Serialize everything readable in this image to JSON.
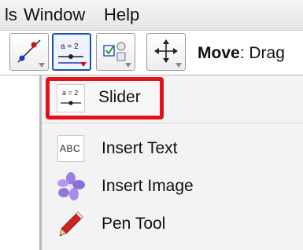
{
  "menubar": {
    "items": [
      "ls",
      "Window",
      "Help"
    ]
  },
  "toolbar": {
    "tools": [
      {
        "icon": "line-through-two-points-icon",
        "selected": false
      },
      {
        "icon": "slider-icon",
        "icon_text": "a = 2",
        "selected": true
      },
      {
        "icon": "checkbox-icon",
        "selected": false
      },
      {
        "icon": "move-icon",
        "selected": false
      }
    ],
    "mode_label": "Move",
    "mode_suffix": ": Drag"
  },
  "dropdown": {
    "items": [
      {
        "label": "Slider",
        "icon": "slider-icon",
        "icon_text": "a = 2",
        "highlighted": true
      },
      {
        "label": "Insert Text",
        "icon": "text-icon",
        "icon_text": "ABC",
        "highlighted": false
      },
      {
        "label": "Insert Image",
        "icon": "image-icon",
        "highlighted": false
      },
      {
        "label": "Pen Tool",
        "icon": "pen-icon",
        "highlighted": false
      }
    ]
  },
  "colors": {
    "highlight": "#e3121a",
    "selected_border": "#1f4fb8"
  }
}
